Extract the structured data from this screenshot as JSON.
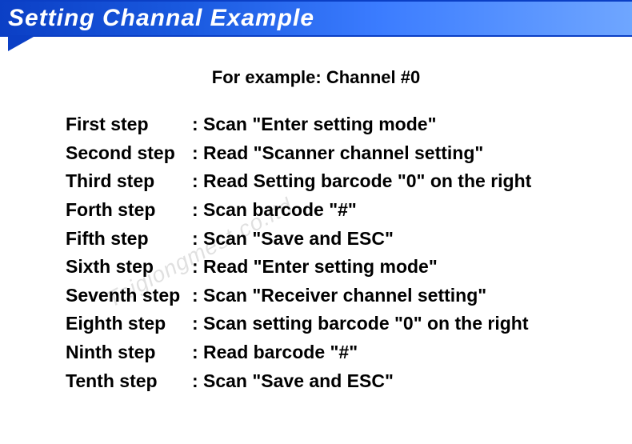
{
  "header": {
    "title": "Setting Channal Example"
  },
  "subtitle": "For example: Channel #0",
  "steps": [
    {
      "label": "First step",
      "text": "Scan \"Enter setting mode\""
    },
    {
      "label": "Second step",
      "text": "Read \"Scanner channel setting\""
    },
    {
      "label": "Third step",
      "text": "Read Setting barcode \"0\" on the right"
    },
    {
      "label": "Forth step",
      "text": "Scan barcode \"#\""
    },
    {
      "label": "Fifth step",
      "text": "Scan \"Save and ESC\""
    },
    {
      "label": "Sixth step",
      "text": "Read \"Enter setting mode\""
    },
    {
      "label": "Seventh step",
      "text": "Scan \"Receiver channel setting\""
    },
    {
      "label": "Eighth step",
      "text": "Scan setting barcode \"0\" on the right"
    },
    {
      "label": "Ninth step",
      "text": "Read barcode \"#\""
    },
    {
      "label": "Tenth step",
      "text": "Scan \"Save and ESC\""
    }
  ],
  "watermark": "Taigiongmest.co.ltd"
}
